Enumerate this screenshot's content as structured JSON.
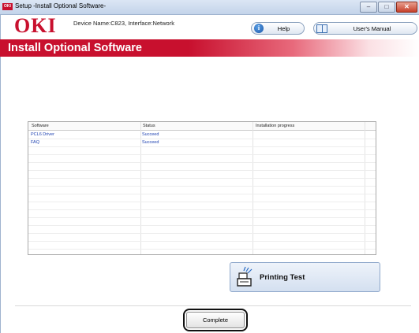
{
  "window": {
    "title": "Setup -Install Optional Software-",
    "app_icon_text": "OKI",
    "min_symbol": "–",
    "max_symbol": "□",
    "close_symbol": "✕"
  },
  "header": {
    "logo": "OKI",
    "device_info": "Device Name:C823, Interface:Network",
    "help_label": "Help",
    "help_icon": "info-icon",
    "manual_label": "User's Manual",
    "manual_icon": "book-icon",
    "brand_color": "#c8102e"
  },
  "banner": {
    "title": "Install Optional Software"
  },
  "table": {
    "columns": [
      "Software",
      "Status",
      "Installation progress"
    ],
    "rows": [
      {
        "software": "PCL6 Driver",
        "status": "Succeed",
        "progress": ""
      },
      {
        "software": "FAQ",
        "status": "Succeed",
        "progress": ""
      }
    ],
    "link_color": "#1b3fb0"
  },
  "actions": {
    "printing_test_label": "Printing Test",
    "printing_test_icon": "printer-icon",
    "complete_label": "Complete"
  }
}
